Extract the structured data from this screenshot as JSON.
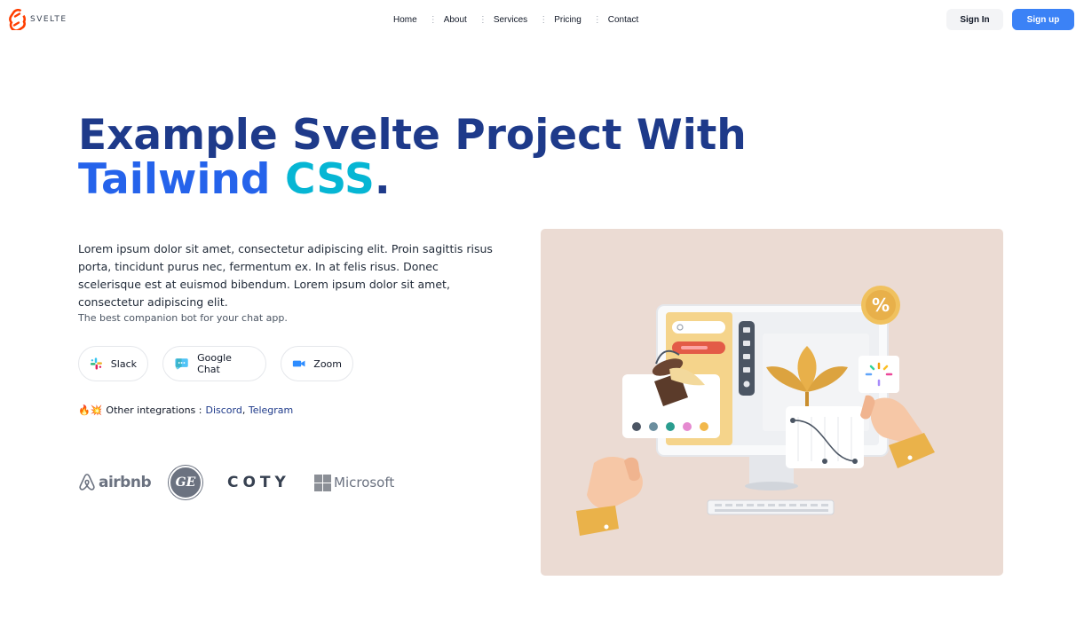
{
  "brand": {
    "name": "SVELTE",
    "color": "#ff3e00"
  },
  "nav": {
    "items": [
      "Home",
      "About",
      "Services",
      "Pricing",
      "Contact"
    ]
  },
  "auth": {
    "signin_label": "Sign In",
    "signup_label": "Sign up"
  },
  "hero": {
    "title_line1": "Example Svelte Project With",
    "title_tailwind": "Tailwind",
    "title_css": "CSS",
    "title_period": ".",
    "description": "Lorem ipsum dolor sit amet, consectetur adipiscing elit. Proin sagittis risus porta, tincidunt purus nec, fermentum ex. In at felis risus. Donec scelerisque est at euismod bibendum. Lorem ipsum dolor sit amet, consectetur adipiscing elit.",
    "tagline": "The best companion bot for your chat app."
  },
  "integrations": {
    "pills": [
      {
        "label": "Slack",
        "icon": "slack-icon"
      },
      {
        "label": "Google Chat",
        "icon": "google-chat-icon"
      },
      {
        "label": "Zoom",
        "icon": "zoom-icon"
      }
    ],
    "emoji": "🔥💥",
    "other_label": "Other integrations :",
    "links": [
      "Discord",
      "Telegram"
    ],
    "separator": ","
  },
  "partners": {
    "airbnb": "airbnb",
    "ge": "GE",
    "coty": "COTY",
    "microsoft": "Microsoft"
  },
  "colors": {
    "title": "#1e3a8a",
    "tailwind": "#2563eb",
    "css": "#06b6d4",
    "primary_button": "#3b82f6",
    "illustration_bg": "#ebdbd3"
  }
}
